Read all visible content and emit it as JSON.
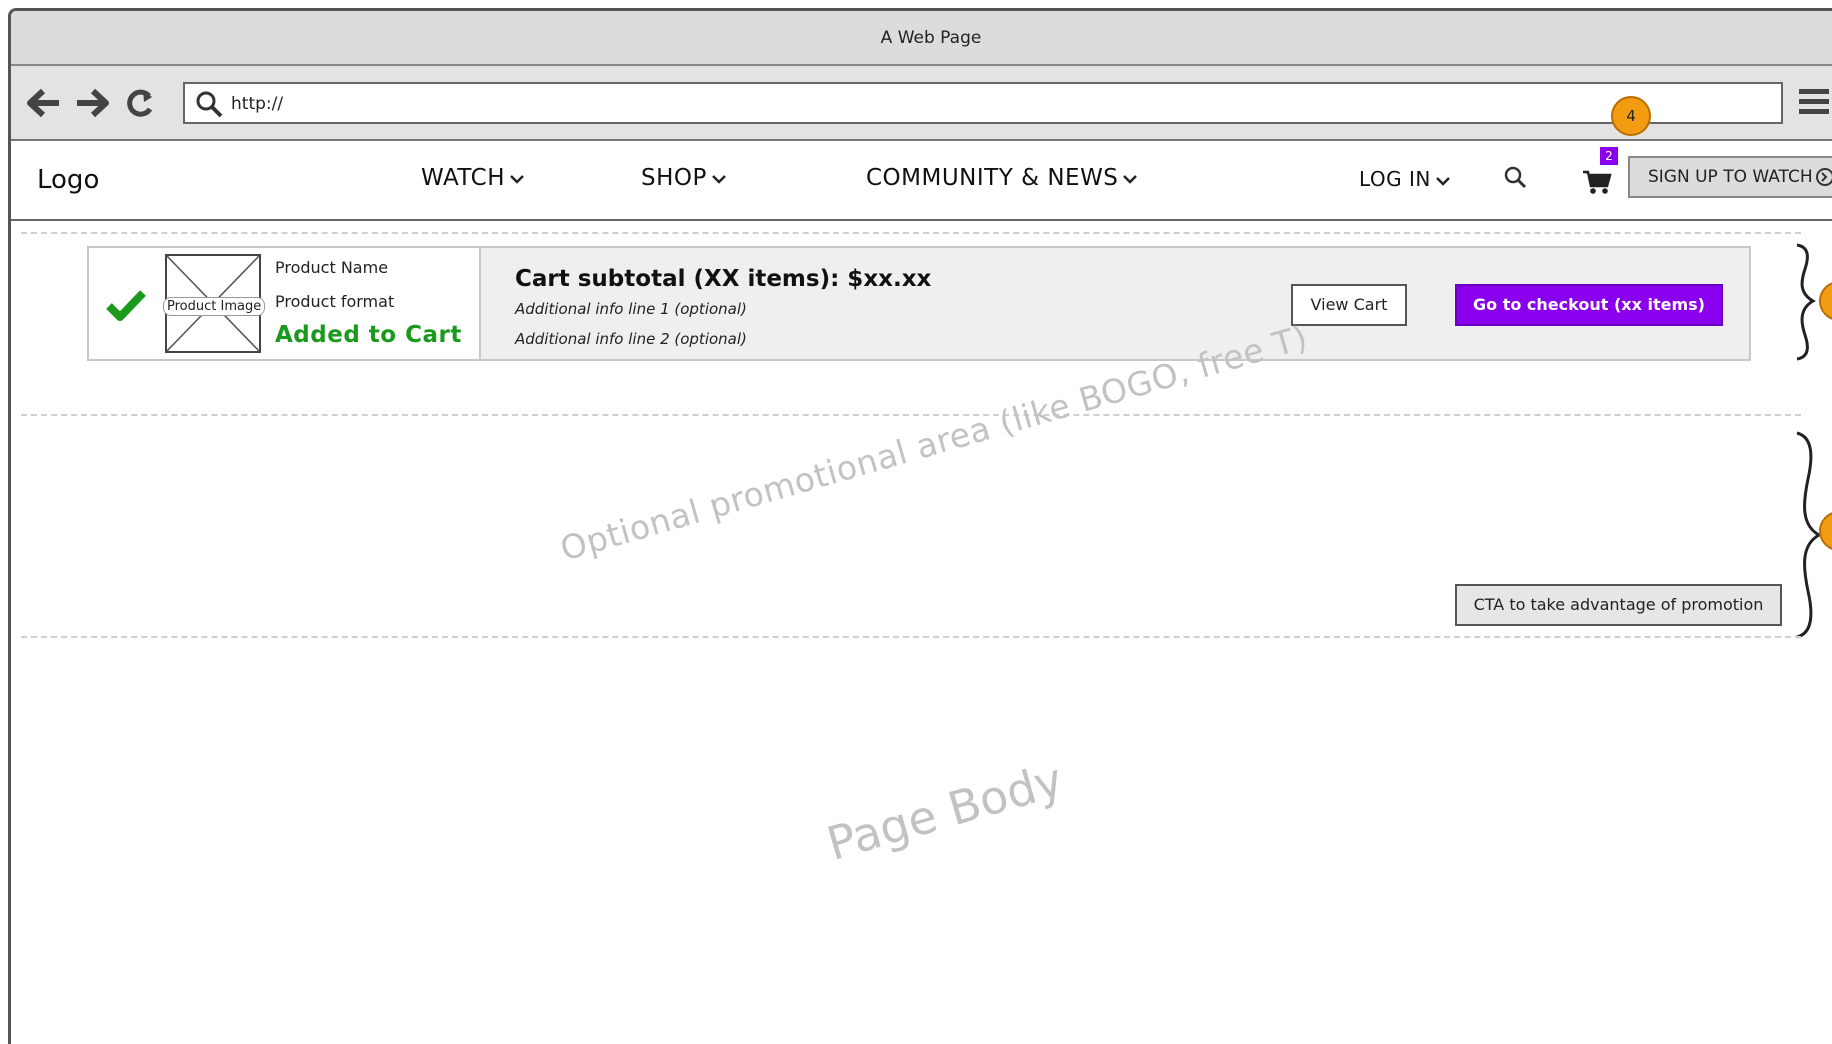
{
  "browser": {
    "title": "A Web Page",
    "url": "http://",
    "annotation_badge": "4"
  },
  "header": {
    "logo": "Logo",
    "nav": {
      "watch": "WATCH",
      "shop": "SHOP",
      "community": "COMMUNITY & NEWS",
      "login": "LOG IN"
    },
    "cart_count": "2",
    "signup_label": "SIGN UP TO WATCH"
  },
  "added_to_cart": {
    "product_image_label": "Product Image",
    "product_name": "Product Name",
    "product_format": "Product format",
    "status": "Added to Cart",
    "subtotal": "Cart subtotal  (XX items):  $xx.xx",
    "info_line_1": "Additional info line 1 (optional)",
    "info_line_2": "Additional info line 2 (optional)",
    "view_cart_label": "View Cart",
    "checkout_label": "Go to checkout (xx items)"
  },
  "promo": {
    "text": "Optional promotional area (like BOGO, free T)",
    "cta_label": "CTA to take advantage of promotion"
  },
  "page_body": {
    "text": "Page Body"
  },
  "colors": {
    "accent": "#8a00ee",
    "success": "#1a9a1a",
    "annotation": "#f39c12"
  }
}
